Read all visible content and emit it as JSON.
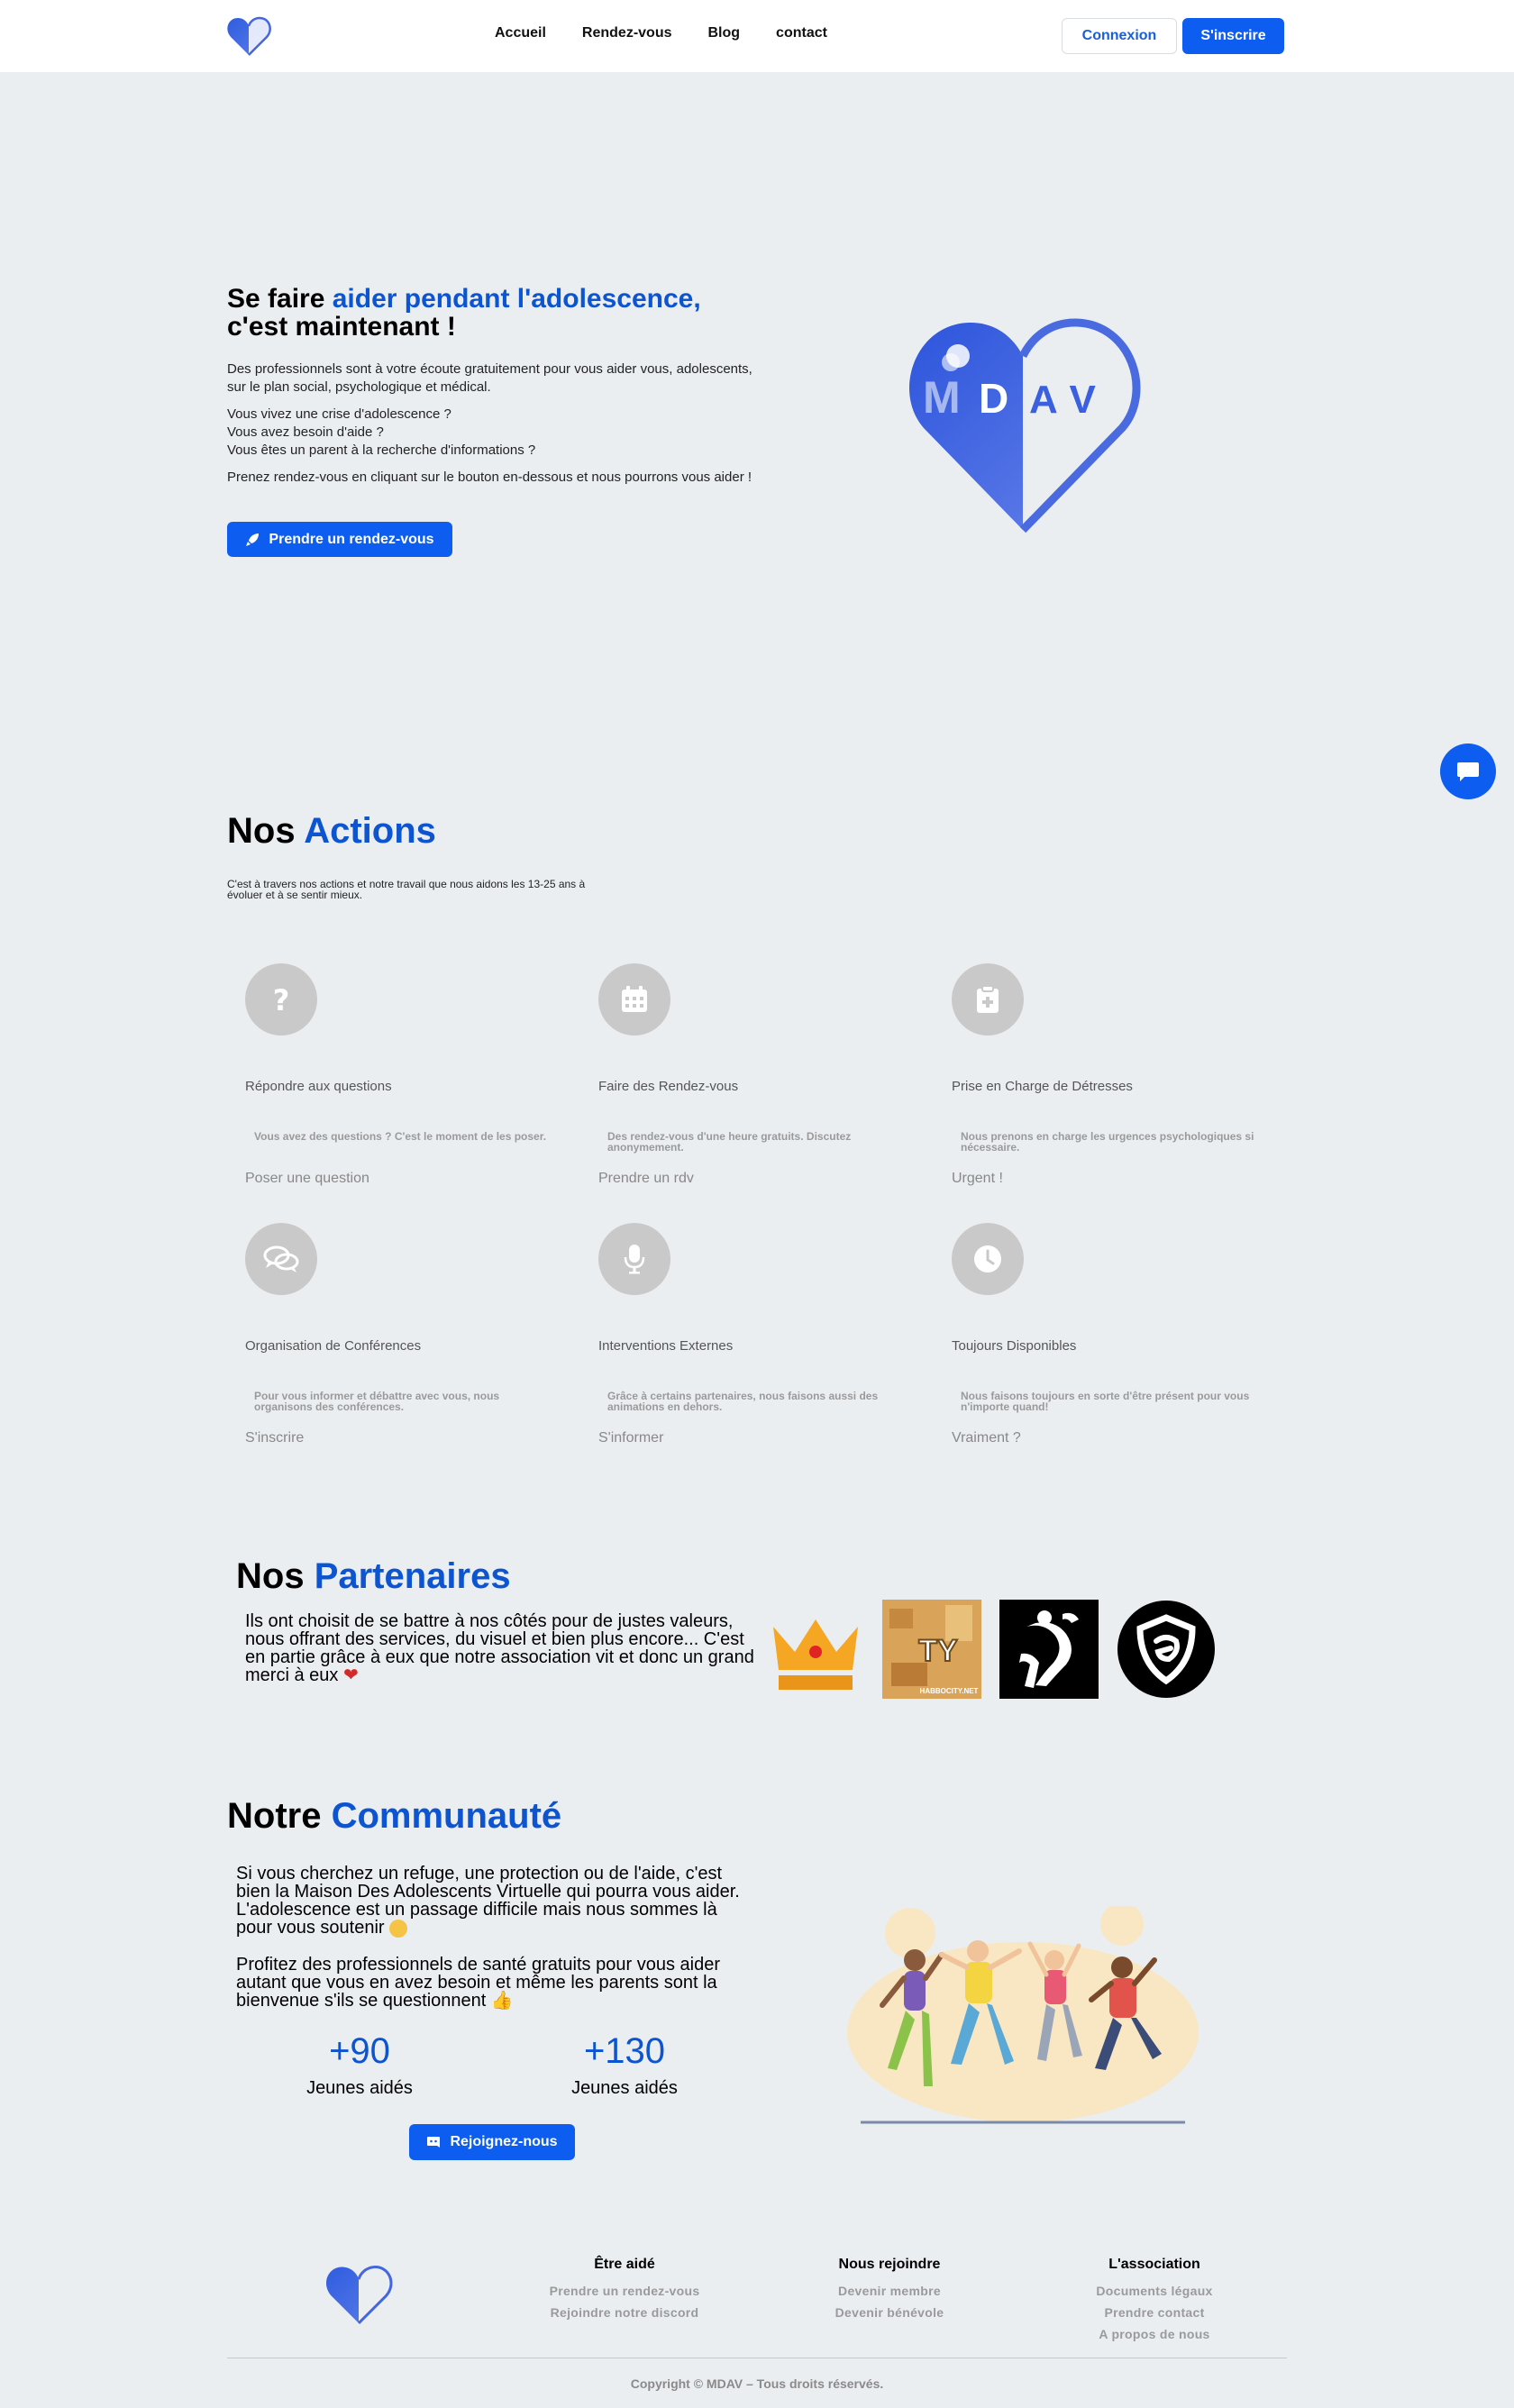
{
  "nav": {
    "links": [
      "Accueil",
      "Rendez-vous",
      "Blog",
      "contact"
    ],
    "login": "Connexion",
    "signup": "S'inscrire"
  },
  "hero": {
    "title_a": "Se faire ",
    "title_accent": "aider pendant l'adolescence,",
    "title_b": "c'est maintenant !",
    "p1": "Des professionnels sont à votre écoute gratuitement pour vous aider vous, adolescents, sur le plan social, psychologique et médical.",
    "p2_l1": "Vous vivez une crise d'adolescence ?",
    "p2_l2": "Vous avez besoin d'aide ?",
    "p2_l3": "Vous êtes un parent à la recherche d'informations ?",
    "p3": "Prenez rendez-vous en cliquant sur le bouton en-dessous et nous pourrons vous aider !",
    "button": "Prendre un rendez-vous",
    "logo_text": "MDAV"
  },
  "actions": {
    "title_a": "Nos ",
    "title_accent": "Actions",
    "subtitle": "C'est à travers nos actions et notre travail que nous aidons les 13-25 ans à évoluer et à se sentir mieux.",
    "cards": [
      {
        "icon": "question-icon",
        "title": "Répondre aux questions",
        "desc": "Vous avez des questions ? C'est le moment de les poser.",
        "link": "Poser une question"
      },
      {
        "icon": "calendar-icon",
        "title": "Faire des Rendez-vous",
        "desc": "Des rendez-vous d'une heure gratuits. Discutez anonymement.",
        "link": "Prendre un rdv"
      },
      {
        "icon": "clipboard-icon",
        "title": "Prise en Charge de Détresses",
        "desc": "Nous prenons en charge les urgences psychologiques si nécessaire.",
        "link": "Urgent !"
      },
      {
        "icon": "chat-bubbles-icon",
        "title": "Organisation de Conférences",
        "desc": "Pour vous informer et débattre avec vous, nous organisons des conférences.",
        "link": "S'inscrire"
      },
      {
        "icon": "microphone-icon",
        "title": "Interventions Externes",
        "desc": "Grâce à certains partenaires, nous faisons aussi des animations en dehors.",
        "link": "S'informer"
      },
      {
        "icon": "clock-icon",
        "title": "Toujours Disponibles",
        "desc": "Nous faisons toujours en sorte d'être présent pour vous n'importe quand!",
        "link": "Vraiment ?"
      }
    ]
  },
  "partners": {
    "title_a": "Nos ",
    "title_accent": "Partenaires",
    "text": "Ils ont choisit de se battre à nos côtés pour de justes valeurs, nous offrant des services, du visuel et bien plus encore... C'est en partie grâce à eux que notre association vit et donc un grand merci à eux",
    "logo2_text": "TY",
    "logo2_sub": "HABBOCITY.NET"
  },
  "community": {
    "title_a": "Notre ",
    "title_accent": "Communauté",
    "p1": "Si vous cherchez un refuge, une protection ou de l'aide, c'est bien la Maison Des Adolescents Virtuelle qui pourra vous aider. L'adolescence est un passage difficile mais nous sommes là pour vous soutenir",
    "p2": "Profitez des professionnels de santé gratuits pour vous aider autant que vous en avez besoin et même les parents sont la bienvenue s'ils se questionnent",
    "stats": [
      {
        "num": "+90",
        "label": "Jeunes aidés"
      },
      {
        "num": "+130",
        "label": "Jeunes aidés"
      }
    ],
    "button": "Rejoignez-nous"
  },
  "footer": {
    "cols": [
      {
        "title": "Être aidé",
        "links": [
          "Prendre un rendez-vous",
          "Rejoindre notre discord"
        ]
      },
      {
        "title": "Nous rejoindre",
        "links": [
          "Devenir membre",
          "Devenir bénévole"
        ]
      },
      {
        "title": "L'association",
        "links": [
          "Documents légaux",
          "Prendre contact",
          "A propos de nous"
        ]
      }
    ],
    "copyright": "Copyright © MDAV – Tous droits réservés."
  },
  "colors": {
    "accent": "#0d55d0",
    "button": "#0d5ef0",
    "background": "#ebeef1"
  }
}
